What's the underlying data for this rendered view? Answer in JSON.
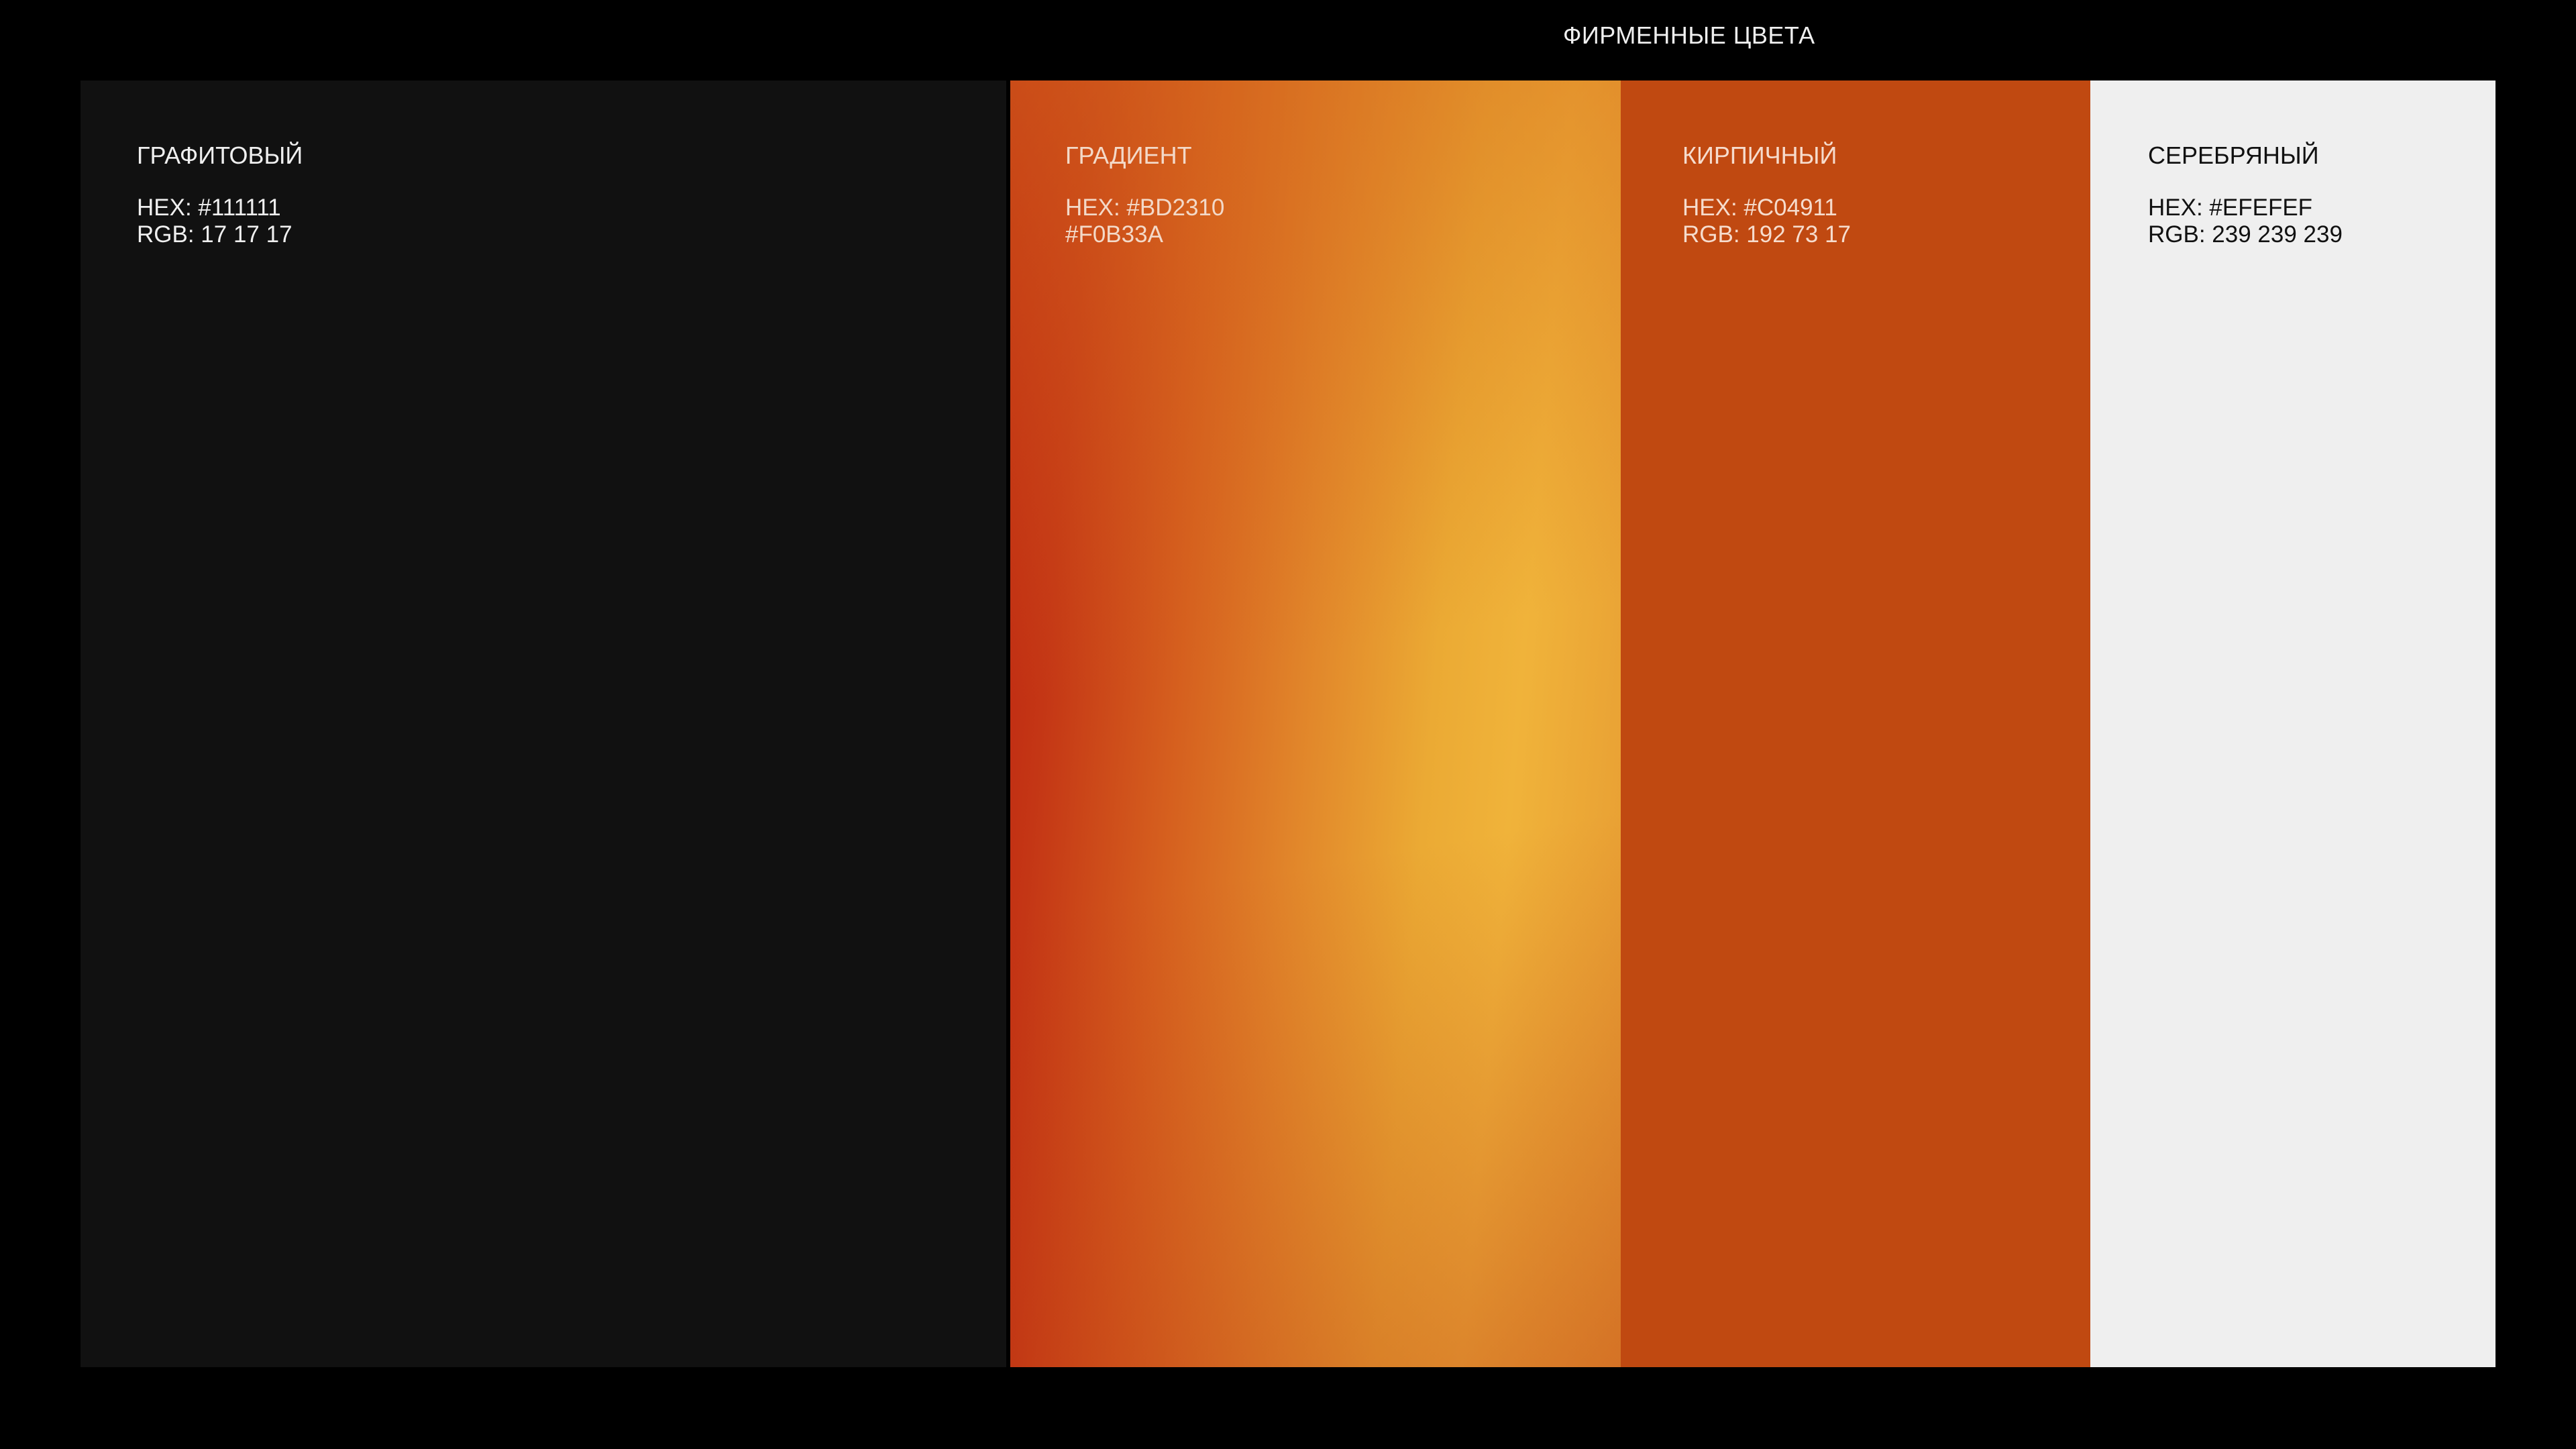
{
  "page": {
    "title": "ФИРМЕННЫЕ ЦВЕТА"
  },
  "swatches": [
    {
      "name": "ГРАФИТОВЫЙ",
      "line1": "HEX: #111111",
      "line2": "RGB: 17 17 17",
      "color": "#111111"
    },
    {
      "name": "ГРАДИЕНТ",
      "line1": "HEX: #BD2310",
      "line2": "#F0B33A",
      "color_from": "#BD2310",
      "color_to": "#F0B33A"
    },
    {
      "name": "КИРПИЧНЫЙ",
      "line1": "HEX: #C04911",
      "line2": "RGB: 192 73 17",
      "color": "#C04911"
    },
    {
      "name": "СЕРЕБРЯНЫЙ",
      "line1": "HEX: #EFEFEF",
      "line2": "RGB: 239 239 239",
      "color": "#EFEFEF"
    }
  ]
}
